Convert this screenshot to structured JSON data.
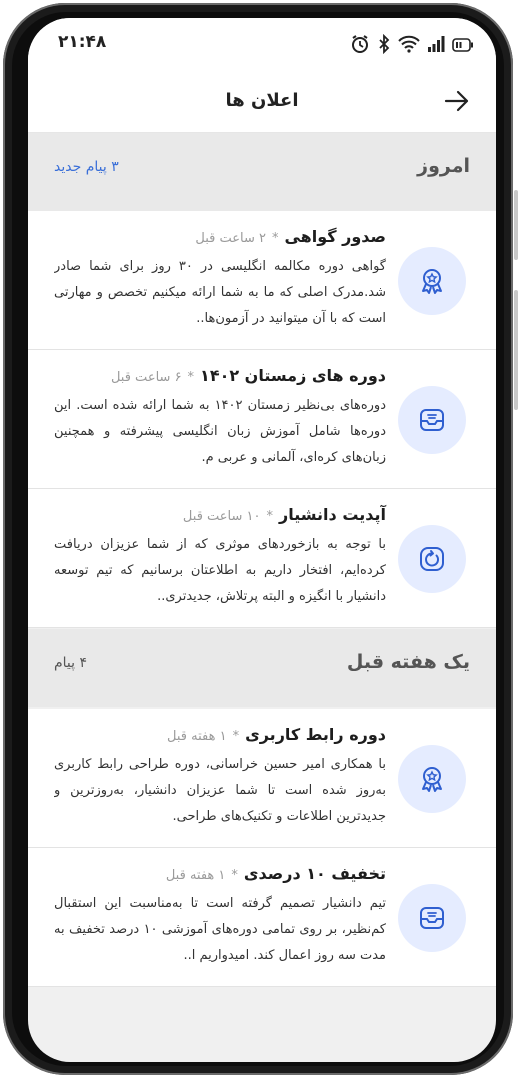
{
  "status_bar": {
    "time": "۲۱:۴۸",
    "icons": [
      "alarm-icon",
      "bluetooth-icon",
      "wifi-icon",
      "signal-icon",
      "battery-icon"
    ]
  },
  "appbar": {
    "title": "اعلان ها",
    "back_icon": "arrow-right-icon"
  },
  "sections": [
    {
      "title": "امروز",
      "count": "۳ پیام جدید",
      "items": [
        {
          "icon": "award-icon",
          "title": "صدور گواهی",
          "star": "*",
          "time": "۲ ساعت قبل",
          "body": "گواهی دوره مکالمه انگلیسی در ۳۰ روز برای شما صادر شد.مدرک اصلی که ما به شما ارائه میکنیم تخصص و مهارتی است که با آن میتوانید در آزمون‌ها.."
        },
        {
          "icon": "inbox-icon",
          "title": "دوره های زمستان ۱۴۰۲",
          "star": "*",
          "time": "۶ ساعت قبل",
          "body": "دوره‌های بی‌نظیر زمستان ۱۴۰۲ به شما ارائه شده است. این دوره‌ها شامل آموزش زبان انگلیسی پیشرفته و همچنین زبان‌های کره‌ای، آلمانی و عربی م."
        },
        {
          "icon": "refresh-icon",
          "title": "آپدیت دانشیار",
          "star": "*",
          "time": "۱۰ ساعت قبل",
          "body": "با توجه به بازخوردهای موثری که از شما عزیزان دریافت کرده‌ایم، افتخار داریم به اطلاعتان برسانیم که تیم توسعه دانشیار با انگیزه و البته پرتلاش، جدیدتری.."
        }
      ]
    },
    {
      "title": "یک هفته قبل",
      "count": "۴ پیام",
      "items": [
        {
          "icon": "award-icon",
          "title": "دوره رابط کاربری",
          "star": "*",
          "time": "۱ هفته قبل",
          "body": "با همکاری امیر حسین خراسانی، دوره طراحی رابط کاربری به‌روز شده است تا شما عزیزان دانشیار، به‌روزترین و جدیدترین اطلاعات و تکنیک‌های طراحی."
        },
        {
          "icon": "inbox-icon",
          "title": "تخفیف ۱۰ درصدی",
          "star": "*",
          "time": "۱ هفته قبل",
          "body": "تیم دانشیار تصمیم گرفته است تا به‌مناسبت این استقبال کم‌نظیر، بر روی تمامی دوره‌های آموزشی ۱۰ درصد تخفیف به مدت سه روز اعمال کند. امیدواریم ا.."
        }
      ]
    }
  ],
  "colors": {
    "accent": "#3a6fd8",
    "icon_bg": "#e5ecff",
    "icon_fg": "#2f5fd0",
    "section_bg": "#e9e9e9"
  }
}
